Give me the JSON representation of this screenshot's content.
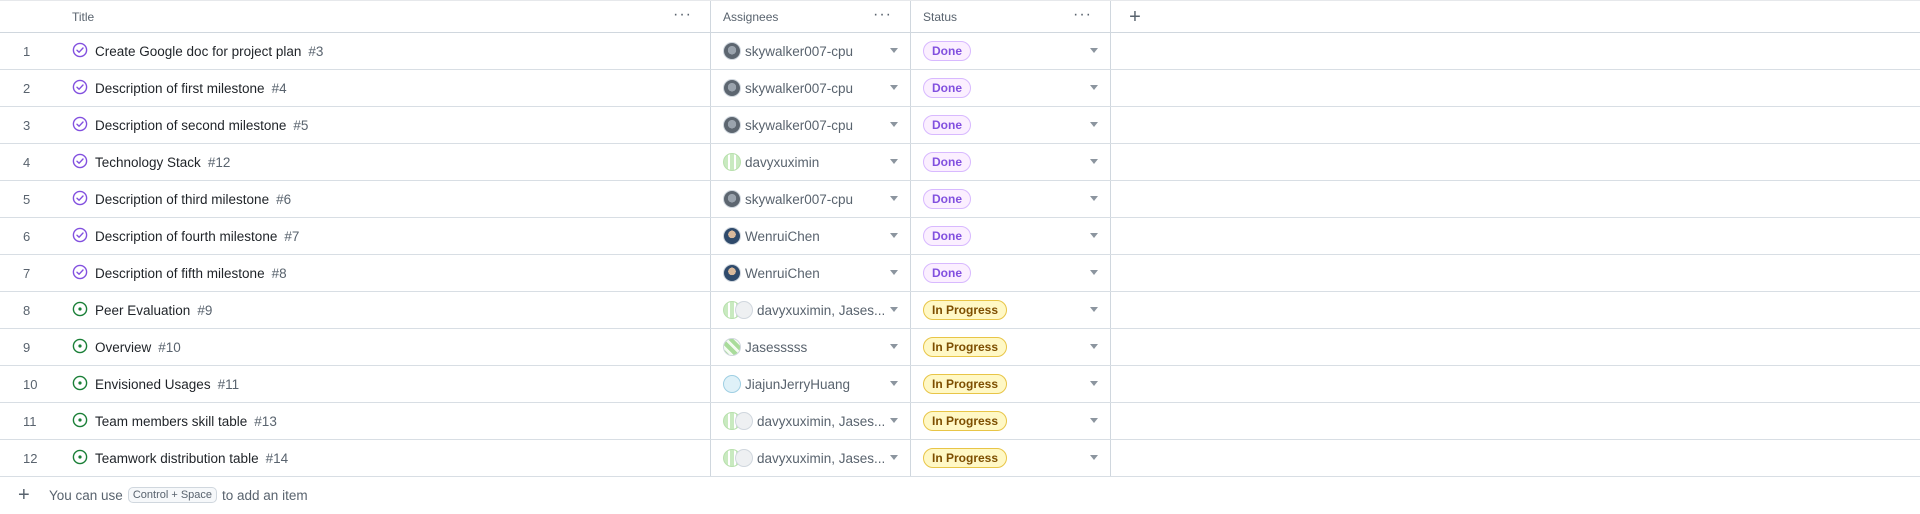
{
  "header": {
    "columns": [
      {
        "label": "Title"
      },
      {
        "label": "Assignees"
      },
      {
        "label": "Status"
      }
    ],
    "more_icon": "kebab-horizontal-icon",
    "add_column_icon": "plus-icon"
  },
  "rows": [
    {
      "num": "1",
      "title": "Create Google doc for project plan",
      "issue": "#3",
      "assignee": "skywalker007-cpu",
      "avatar": "sky",
      "status": "Done"
    },
    {
      "num": "2",
      "title": "Description of first milestone",
      "issue": "#4",
      "assignee": "skywalker007-cpu",
      "avatar": "sky",
      "status": "Done"
    },
    {
      "num": "3",
      "title": "Description of second milestone",
      "issue": "#5",
      "assignee": "skywalker007-cpu",
      "avatar": "sky",
      "status": "Done"
    },
    {
      "num": "4",
      "title": "Technology Stack",
      "issue": "#12",
      "assignee": "davyxuximin",
      "avatar": "davy",
      "status": "Done"
    },
    {
      "num": "5",
      "title": "Description of third milestone",
      "issue": "#6",
      "assignee": "skywalker007-cpu",
      "avatar": "sky",
      "status": "Done"
    },
    {
      "num": "6",
      "title": "Description of fourth milestone",
      "issue": "#7",
      "assignee": "WenruiChen",
      "avatar": "wen",
      "status": "Done"
    },
    {
      "num": "7",
      "title": "Description of fifth milestone",
      "issue": "#8",
      "assignee": "WenruiChen",
      "avatar": "wen",
      "status": "Done"
    },
    {
      "num": "8",
      "title": "Peer Evaluation",
      "issue": "#9",
      "assignee": "davyxuximin, Jases...",
      "avatar": "pair",
      "status": "In Progress"
    },
    {
      "num": "9",
      "title": "Overview",
      "issue": "#10",
      "assignee": "Jasesssss",
      "avatar": "jas",
      "status": "In Progress"
    },
    {
      "num": "10",
      "title": "Envisioned Usages",
      "issue": "#11",
      "assignee": "JiajunJerryHuang",
      "avatar": "jia",
      "status": "In Progress"
    },
    {
      "num": "11",
      "title": "Team members skill table",
      "issue": "#13",
      "assignee": "davyxuximin, Jases...",
      "avatar": "pair",
      "status": "In Progress"
    },
    {
      "num": "12",
      "title": "Teamwork distribution table",
      "issue": "#14",
      "assignee": "davyxuximin, Jases...",
      "avatar": "pair",
      "status": "In Progress"
    }
  ],
  "footer": {
    "prefix": "You can use",
    "shortcut": "Control + Space",
    "suffix": "to add an item"
  },
  "colors": {
    "done_icon": "#8250df",
    "progress_icon": "#1a7f37",
    "done_badge_text": "#8250df",
    "progress_badge_text": "#7d4e00"
  }
}
